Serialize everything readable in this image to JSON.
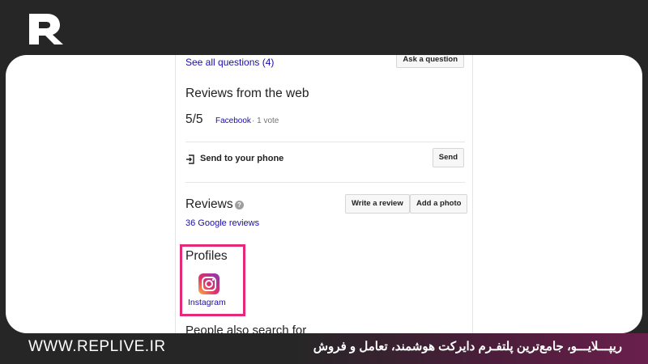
{
  "brand": {
    "logo_icon": "replive-logo-icon",
    "website": "WWW.REPLIVE.IR",
    "tagline": "ریپـــلایـــو، جامع‌ترین پلتفـرم دایرکت هوشمند، تعامل و فروش",
    "accent_color": "#e6287a"
  },
  "questions": {
    "see_all": "See all questions (4)",
    "ask_button": "Ask a question"
  },
  "web_reviews": {
    "heading": "Reviews from the web",
    "score": "5/5",
    "source": "Facebook",
    "votes": "· 1 vote"
  },
  "send_to_phone": {
    "icon": "send-to-phone-icon",
    "label": "Send to your phone",
    "button": "Send"
  },
  "reviews": {
    "heading": "Reviews",
    "help_icon": "help-icon",
    "count_link": "36 Google reviews",
    "write_button": "Write a review",
    "photo_button": "Add a photo"
  },
  "profiles": {
    "heading": "Profiles",
    "items": [
      {
        "icon": "instagram-icon",
        "label": "Instagram"
      }
    ]
  },
  "cut_off_heading": "People also search for"
}
